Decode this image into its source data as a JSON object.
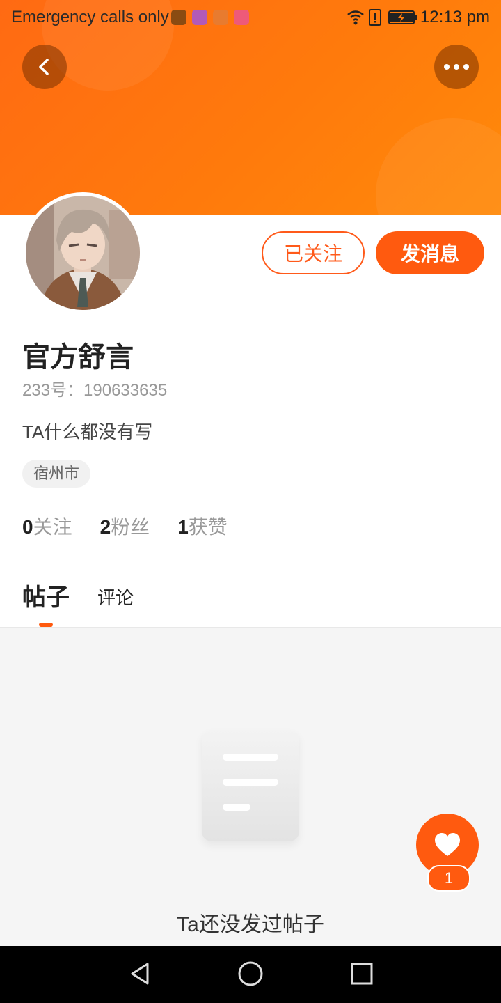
{
  "status_bar": {
    "carrier": "Emergency calls only",
    "time": "12:13 pm",
    "notif_colors": [
      "#8a4b12",
      "#b25ab8",
      "#e87b2f",
      "#ee5a79"
    ]
  },
  "header": {
    "accent": "#ff5a0f"
  },
  "profile": {
    "name": "官方舒言",
    "uid": "233号：190633635",
    "bio": "TA什么都没有写",
    "location": "宿州市"
  },
  "actions": {
    "followed_label": "已关注",
    "message_label": "发消息"
  },
  "stats": [
    {
      "count": "0",
      "label": "关注"
    },
    {
      "count": "2",
      "label": "粉丝"
    },
    {
      "count": "1",
      "label": "获赞"
    }
  ],
  "tabs": [
    {
      "label": "帖子",
      "active": true
    },
    {
      "label": "评论",
      "active": false
    }
  ],
  "empty_state": {
    "text": "Ta还没发过帖子"
  },
  "like": {
    "count": "1"
  },
  "icons": {
    "back": "chevron-left-icon",
    "more": "more-dots-icon",
    "like": "heart-icon"
  }
}
